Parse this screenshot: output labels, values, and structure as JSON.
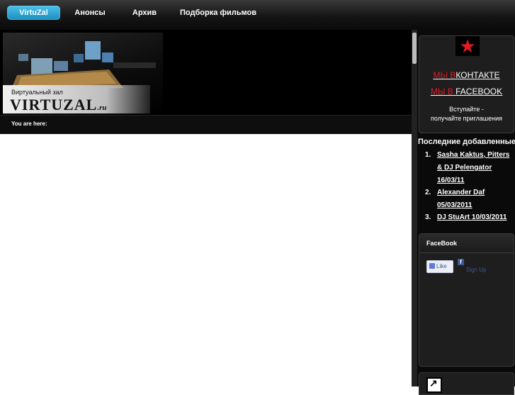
{
  "nav": {
    "items": [
      {
        "label": "VirtuZal",
        "active": true
      },
      {
        "label": "Анонсы",
        "active": false
      },
      {
        "label": "Архив",
        "active": false
      },
      {
        "label": "Подборка фильмов",
        "active": false
      }
    ]
  },
  "header": {
    "logo_subtitle": "Виртуальный зал",
    "logo_title": "VIRTUZAL",
    "logo_suffix": ".ru",
    "breadcrumb_label": "You are here:"
  },
  "sidebar": {
    "social": {
      "vk": {
        "red": "МЫ В",
        "white": "КОНТАКТЕ"
      },
      "facebook": {
        "red": "МЫ В",
        "white": " FACEBOOK"
      },
      "join_line1": "Вступайте -",
      "join_line2": "получайте приглашения"
    },
    "recent_title": "Последние добавленные",
    "recent": [
      {
        "num": "1.",
        "text": "Sasha Kaktus, Pitters & DJ Pelengator 16/03/11"
      },
      {
        "num": "2.",
        "text": "Alexander Daf 05/03/2011"
      },
      {
        "num": "3.",
        "text": "DJ StuArt 10/03/2011"
      }
    ],
    "facebook_panel": {
      "title": "FaceBook",
      "like_label": "Like",
      "fb_letter": "f",
      "signup_label": "Sign Up"
    }
  },
  "colors": {
    "accent": "#1a8fc0",
    "red": "#e31b23",
    "fb": "#3b5998"
  }
}
